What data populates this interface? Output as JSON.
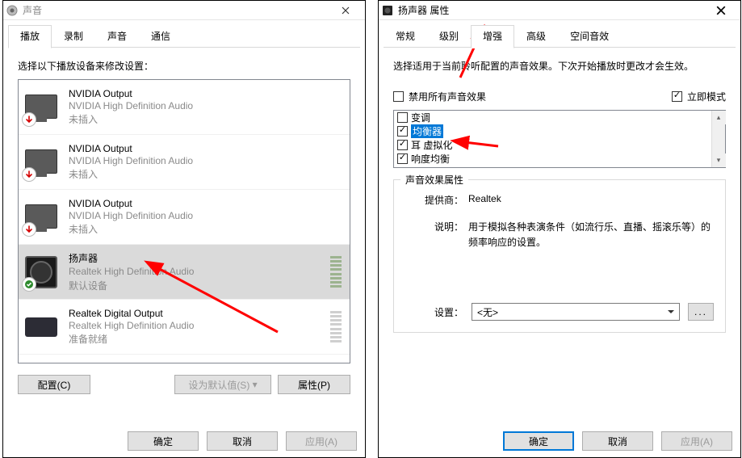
{
  "sound_window": {
    "title": "声音",
    "tabs": {
      "playback": "播放",
      "recording": "录制",
      "sounds": "声音",
      "comm": "通信"
    },
    "instruction": "选择以下播放设备来修改设置：",
    "devices": [
      {
        "name": "NVIDIA Output",
        "provider": "NVIDIA High Definition Audio",
        "status": "未插入",
        "badge": "down"
      },
      {
        "name": "NVIDIA Output",
        "provider": "NVIDIA High Definition Audio",
        "status": "未插入",
        "badge": "down"
      },
      {
        "name": "NVIDIA Output",
        "provider": "NVIDIA High Definition Audio",
        "status": "未插入",
        "badge": "down"
      },
      {
        "name": "扬声器",
        "provider": "Realtek High Definition Audio",
        "status": "默认设备",
        "badge": "check"
      },
      {
        "name": "Realtek Digital Output",
        "provider": "Realtek High Definition Audio",
        "status": "准备就绪",
        "badge": "none"
      }
    ],
    "buttons": {
      "configure": "配置(C)",
      "set_default": "设为默认值(S)",
      "properties": "属性(P)"
    },
    "dialog_buttons": {
      "ok": "确定",
      "cancel": "取消",
      "apply": "应用(A)"
    }
  },
  "speaker_window": {
    "title": "扬声器 属性",
    "tabs": {
      "general": "常规",
      "level": "级别",
      "enhance": "增强",
      "advanced": "高级",
      "spatial": "空间音效"
    },
    "desc": "选择适用于当前聆听配置的声音效果。下次开始播放时更改才会生效。",
    "disable_all": "禁用所有声音效果",
    "immediate": "立即模式",
    "effects": [
      {
        "label": "变调",
        "checked": false
      },
      {
        "label": "均衡器",
        "checked": true,
        "selected": true
      },
      {
        "label": "耳  虚拟化",
        "checked": true
      },
      {
        "label": "响度均衡",
        "checked": true
      }
    ],
    "fx_frame_title": "声音效果属性",
    "provider_label": "提供商：",
    "provider_value": "Realtek",
    "desc_label": "说明：",
    "desc_value": "用于模拟各种表演条件（如流行乐、直播、摇滚乐等）的频率响应的设置。",
    "setting_label": "设置：",
    "setting_value": "<无>",
    "icon_btn": "...",
    "dialog_buttons": {
      "ok": "确定",
      "cancel": "取消",
      "apply": "应用(A)"
    }
  }
}
